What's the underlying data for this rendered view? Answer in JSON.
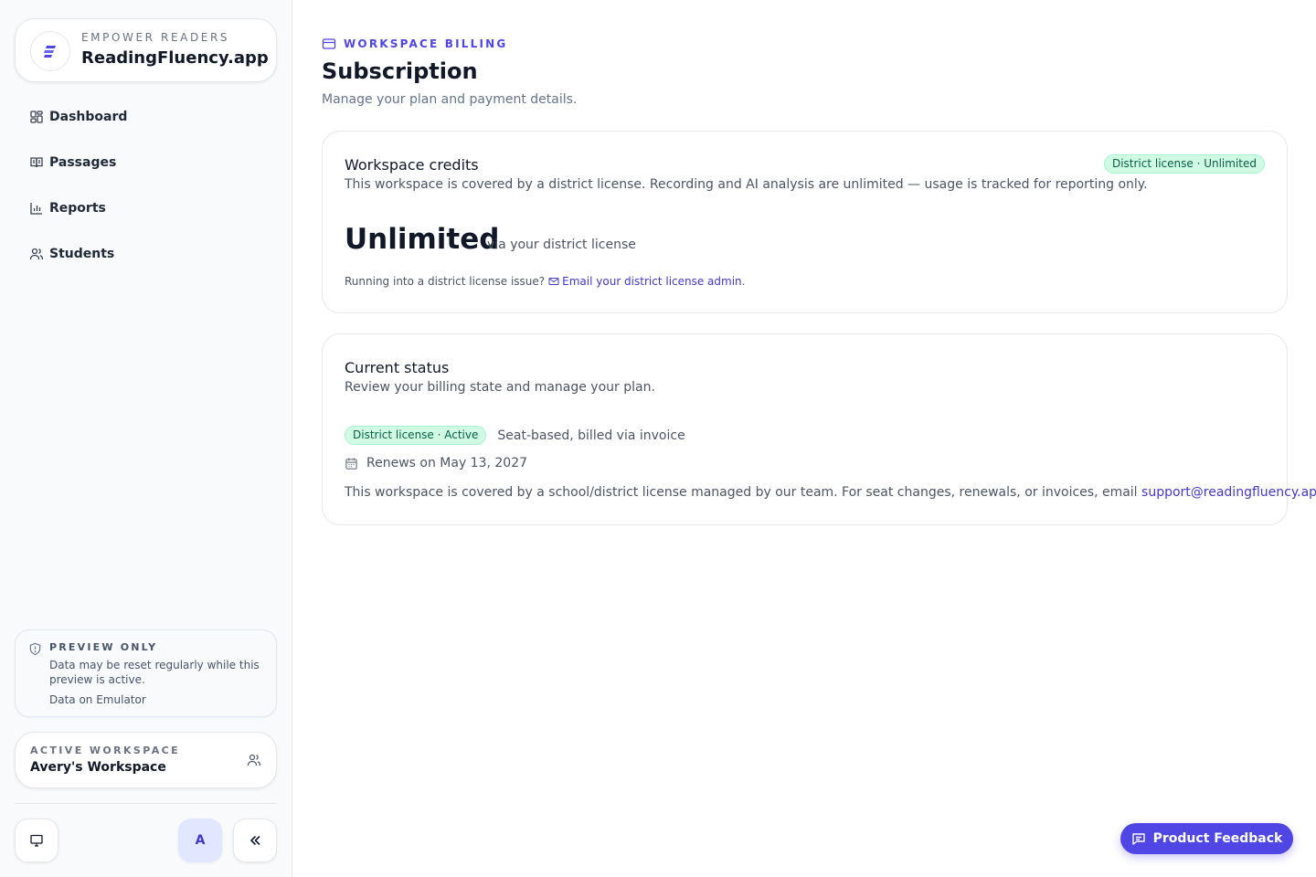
{
  "brand": {
    "eyebrow": "EMPOWER READERS",
    "name": "ReadingFluency.app",
    "logo_icon": "stacked-lines-logo-icon"
  },
  "nav": {
    "items": [
      {
        "label": "Dashboard",
        "icon": "dashboard-icon"
      },
      {
        "label": "Passages",
        "icon": "book-open-icon"
      },
      {
        "label": "Reports",
        "icon": "bar-chart-icon"
      },
      {
        "label": "Students",
        "icon": "users-icon"
      }
    ]
  },
  "preview": {
    "title": "PREVIEW ONLY",
    "text": "Data may be reset regularly while this preview is active.",
    "link": "Data on Emulator"
  },
  "workspace": {
    "eyebrow": "ACTIVE WORKSPACE",
    "name": "Avery's Workspace"
  },
  "footer": {
    "avatar_initial": "A"
  },
  "header": {
    "eyebrow": "WORKSPACE BILLING",
    "title": "Subscription",
    "subtitle": "Manage your plan and payment details."
  },
  "credits": {
    "title": "Workspace credits",
    "description": "This workspace is covered by a district license. Recording and AI analysis are unlimited — usage is tracked for reporting only.",
    "badge": "District license · Unlimited",
    "value": "Unlimited",
    "value_sub": "via your district license",
    "issue_prefix": "Running into a district license issue?",
    "issue_link": "Email your district license admin",
    "issue_suffix": "."
  },
  "status": {
    "title": "Current status",
    "description": "Review your billing state and manage your plan.",
    "badge": "District license · Active",
    "billing_text": "Seat-based, billed via invoice",
    "renewal": "Renews on May 13, 2027",
    "note_prefix": "This workspace is covered by a school/district license managed by our team. For seat changes, renewals, or invoices, email ",
    "note_email": "support@readingfluency.app",
    "note_suffix": "."
  },
  "feedback": {
    "label": "Product Feedback"
  },
  "colors": {
    "accent": "#4f46e5",
    "badge_bg": "#d1fae5",
    "badge_text": "#065f46",
    "sidebar_bg": "#f9fafb"
  }
}
